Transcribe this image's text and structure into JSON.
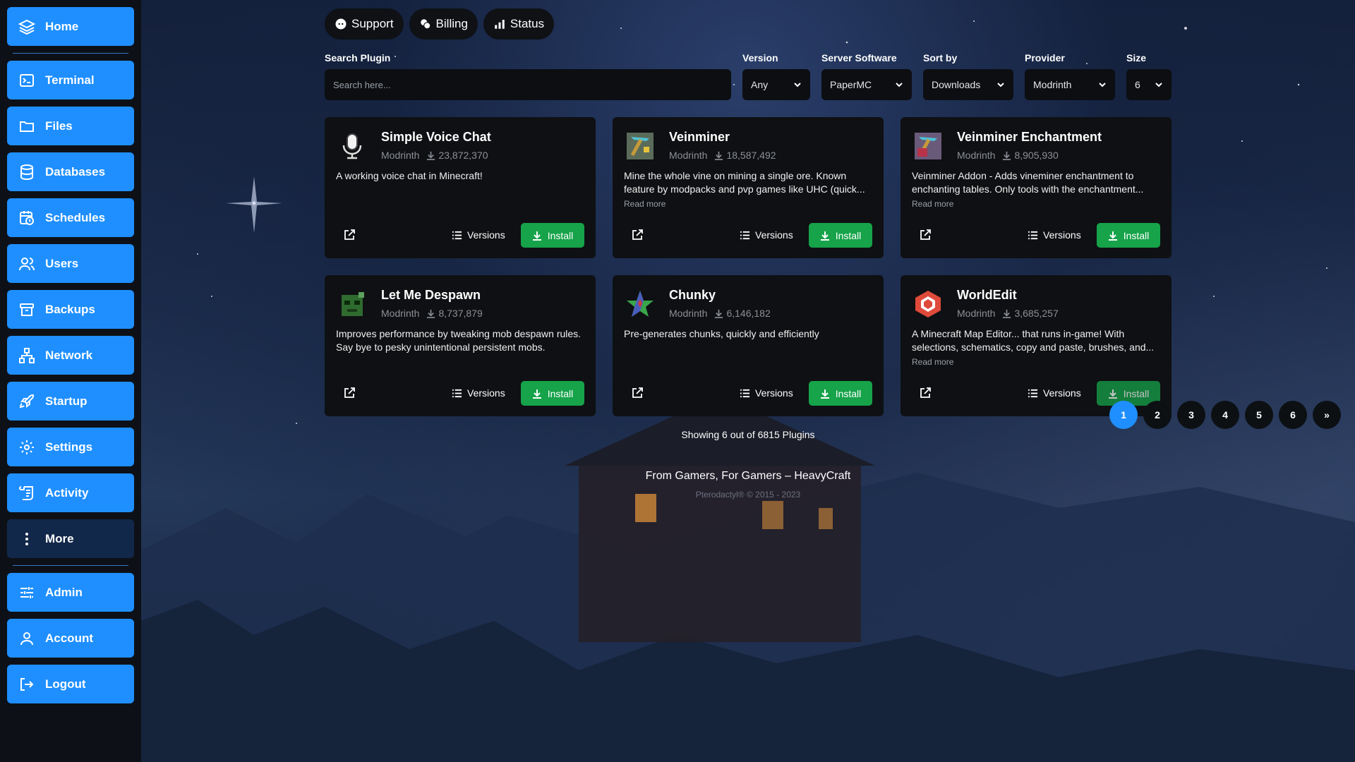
{
  "sidebar": {
    "items": [
      {
        "label": "Home",
        "icon": "layers-icon"
      },
      {
        "label": "Terminal",
        "icon": "terminal-icon"
      },
      {
        "label": "Files",
        "icon": "folder-icon"
      },
      {
        "label": "Databases",
        "icon": "database-icon"
      },
      {
        "label": "Schedules",
        "icon": "calendar-clock-icon"
      },
      {
        "label": "Users",
        "icon": "users-icon"
      },
      {
        "label": "Backups",
        "icon": "archive-icon"
      },
      {
        "label": "Network",
        "icon": "network-icon"
      },
      {
        "label": "Startup",
        "icon": "rocket-icon"
      },
      {
        "label": "Settings",
        "icon": "gear-icon"
      },
      {
        "label": "Activity",
        "icon": "scroll-icon"
      },
      {
        "label": "More",
        "icon": "more-vertical-icon"
      },
      {
        "label": "Admin",
        "icon": "sliders-icon"
      },
      {
        "label": "Account",
        "icon": "user-icon"
      },
      {
        "label": "Logout",
        "icon": "logout-icon"
      }
    ]
  },
  "top_links": [
    {
      "label": "Support",
      "icon": "discord-icon"
    },
    {
      "label": "Billing",
      "icon": "coins-icon"
    },
    {
      "label": "Status",
      "icon": "bar-chart-icon"
    }
  ],
  "filters": {
    "search_label": "Search Plugin",
    "search_placeholder": "Search here...",
    "version_label": "Version",
    "version_value": "Any",
    "software_label": "Server Software",
    "software_value": "PaperMC",
    "sort_label": "Sort by",
    "sort_value": "Downloads",
    "provider_label": "Provider",
    "provider_value": "Modrinth",
    "size_label": "Size",
    "size_value": "6"
  },
  "plugins": [
    {
      "name": "Simple Voice Chat",
      "provider": "Modrinth",
      "downloads": "23,872,370",
      "description": "A working voice chat in Minecraft!",
      "read_more": "",
      "icon": "microphone-icon",
      "versions_label": "Versions",
      "install_label": "Install"
    },
    {
      "name": "Veinminer",
      "provider": "Modrinth",
      "downloads": "18,587,492",
      "description": "Mine the whole vine on mining a single ore. Known feature by modpacks and pvp games like UHC (quick...",
      "read_more": "Read more",
      "icon": "pickaxe-icon",
      "versions_label": "Versions",
      "install_label": "Install"
    },
    {
      "name": "Veinminer Enchantment",
      "provider": "Modrinth",
      "downloads": "8,905,930",
      "description": "Veinminer Addon - Adds vineminer enchantment to enchanting tables. Only tools with the enchantment...",
      "read_more": "Read more",
      "icon": "enchanted-pickaxe-icon",
      "versions_label": "Versions",
      "install_label": "Install"
    },
    {
      "name": "Let Me Despawn",
      "provider": "Modrinth",
      "downloads": "8,737,879",
      "description": "Improves performance by tweaking mob despawn rules. Say bye to pesky unintentional persistent mobs.",
      "read_more": "",
      "icon": "zombie-head-icon",
      "versions_label": "Versions",
      "install_label": "Install"
    },
    {
      "name": "Chunky",
      "provider": "Modrinth",
      "downloads": "6,146,182",
      "description": "Pre-generates chunks, quickly and efficiently",
      "read_more": "",
      "icon": "star-icon",
      "versions_label": "Versions",
      "install_label": "Install"
    },
    {
      "name": "WorldEdit",
      "provider": "Modrinth",
      "downloads": "3,685,257",
      "description": "A Minecraft Map Editor... that runs in-game! With selections, schematics, copy and paste, brushes, and...",
      "read_more": "Read more",
      "icon": "worldedit-logo-icon",
      "versions_label": "Versions",
      "install_label": "Install"
    }
  ],
  "pagination": {
    "pages": [
      "1",
      "2",
      "3",
      "4",
      "5",
      "6"
    ],
    "active": "1",
    "next_label": "»"
  },
  "showing_text": "Showing 6 out of 6815 Plugins",
  "footer": {
    "tagline": "From Gamers, For Gamers – HeavyCraft",
    "copyright": "Pterodactyl® © 2015 - 2023"
  },
  "colors": {
    "accent": "#1f8fff",
    "install": "#16a34a",
    "card": "#0f1013"
  }
}
